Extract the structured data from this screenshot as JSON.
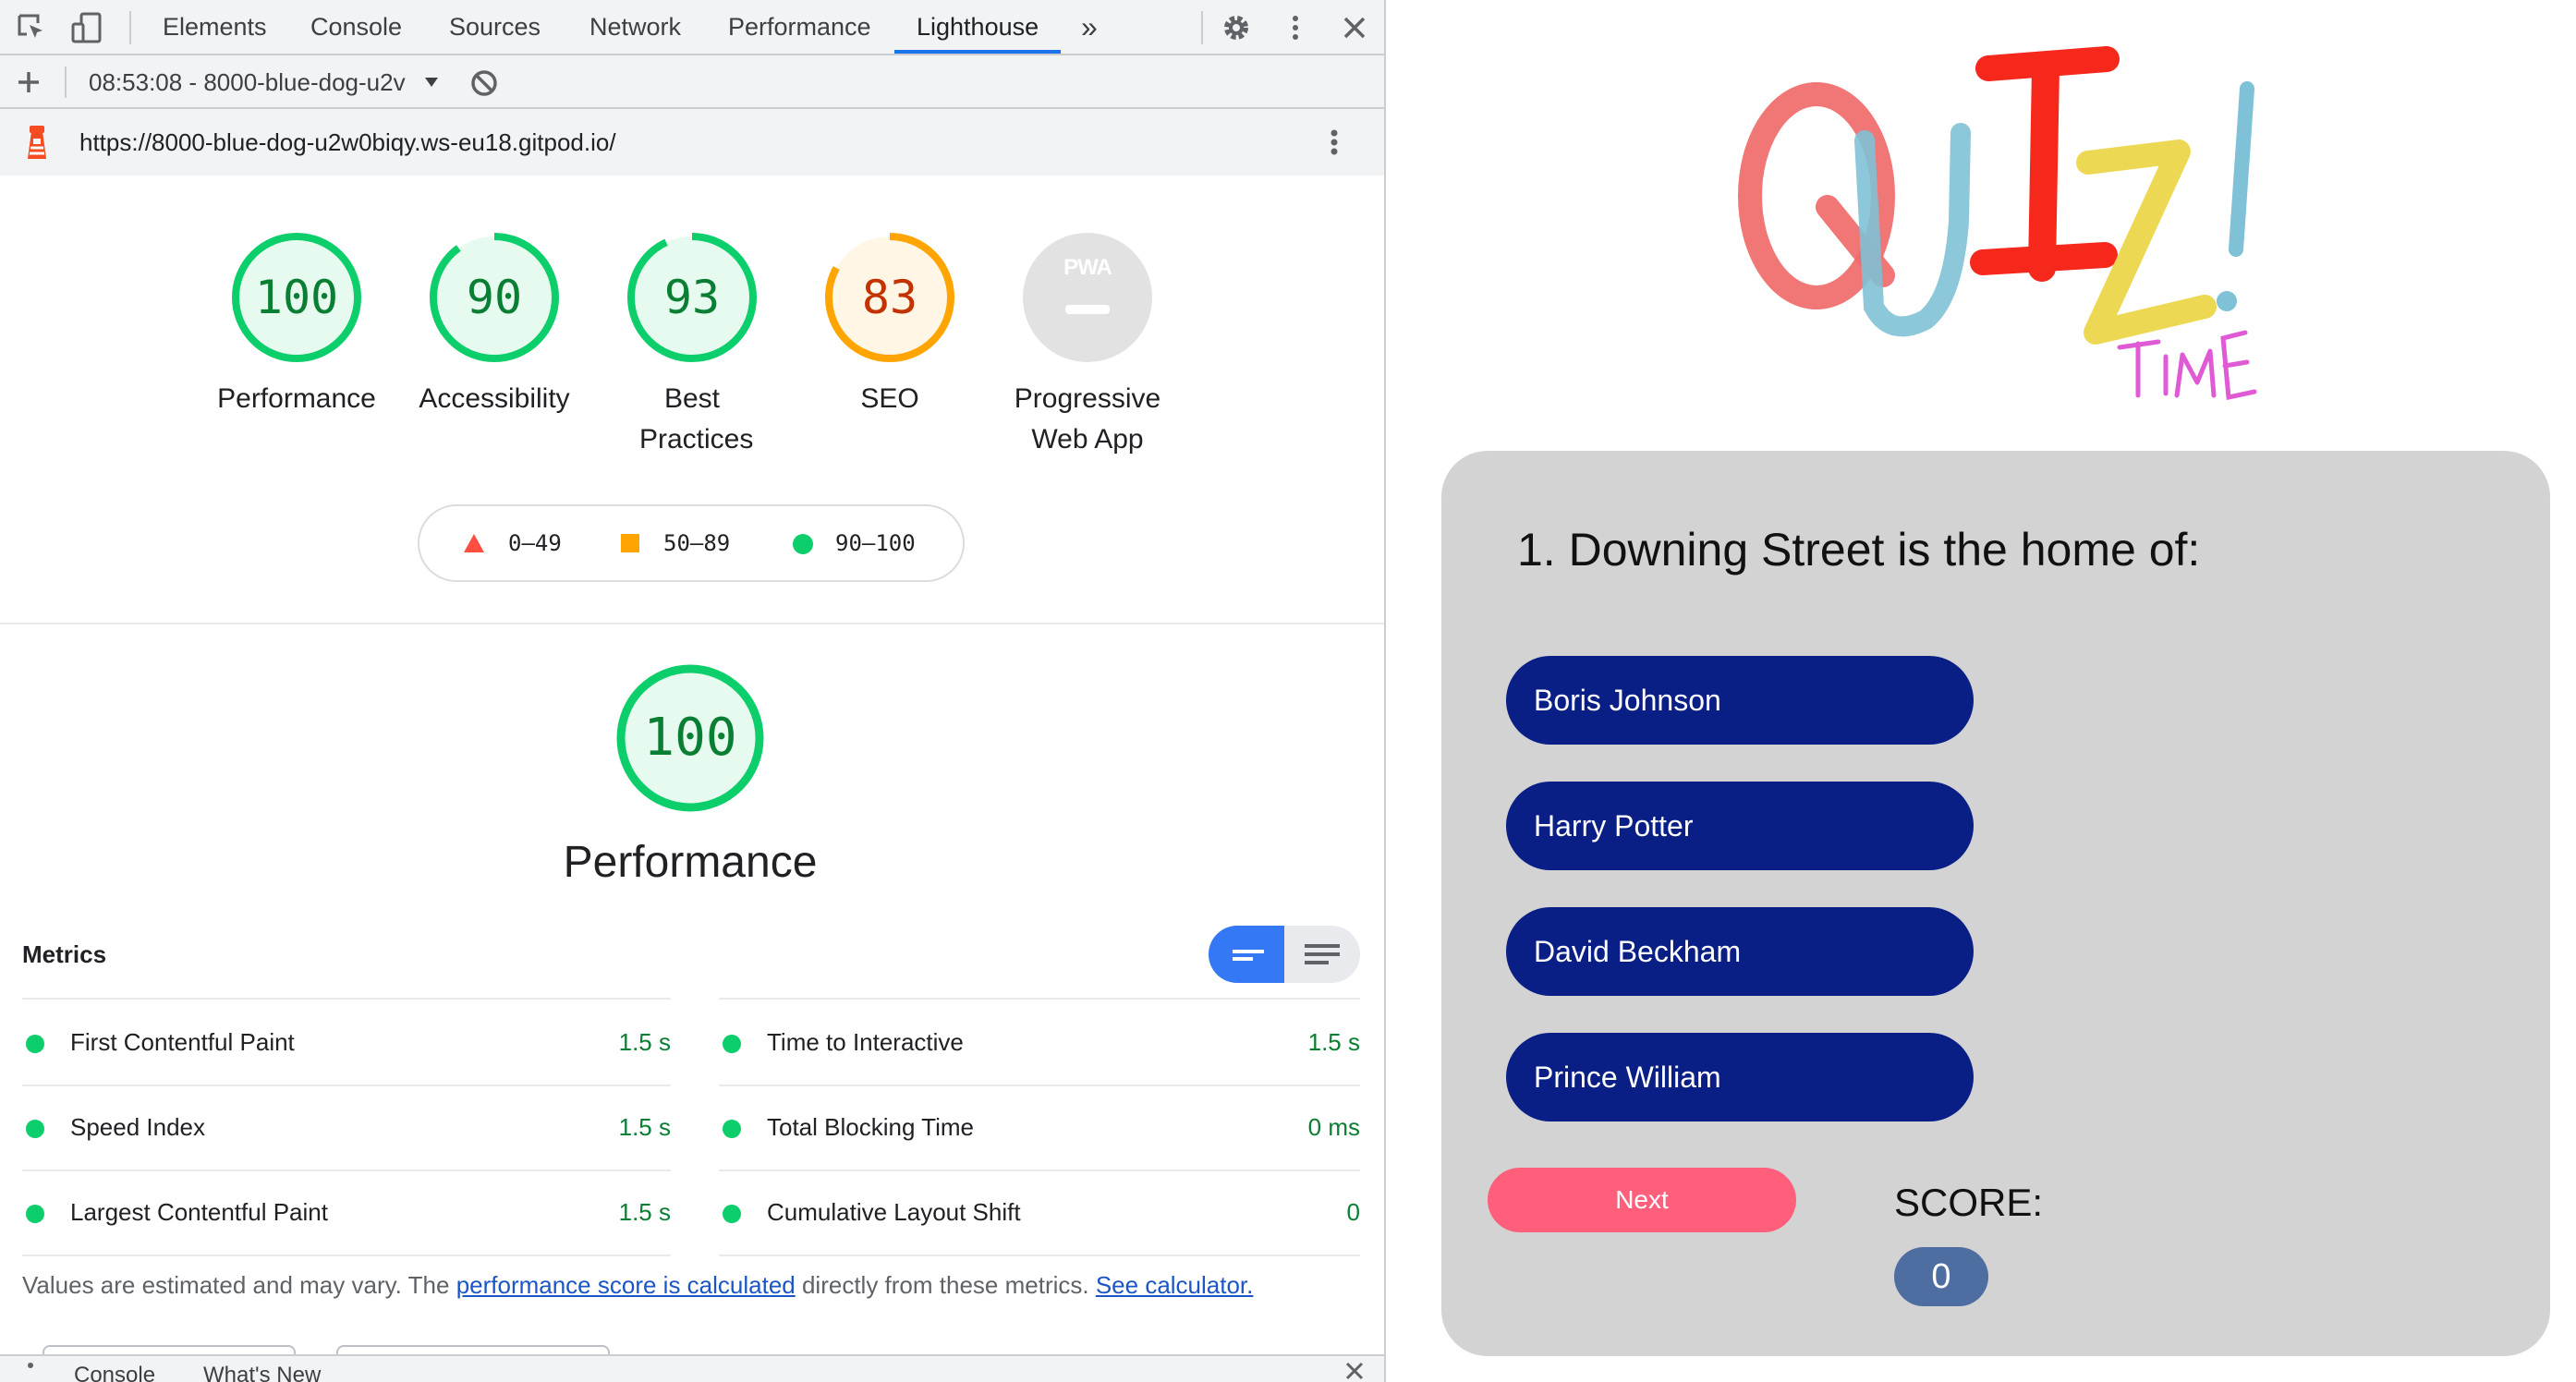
{
  "devtools": {
    "tabs": [
      "Elements",
      "Console",
      "Sources",
      "Network",
      "Performance",
      "Lighthouse"
    ],
    "more_tabs_glyph": "»",
    "report_selector": "08:53:08 - 8000-blue-dog-u2v",
    "url": "https://8000-blue-dog-u2w0biqy.ws-eu18.gitpod.io/",
    "scores": [
      {
        "value": "100",
        "label": "Performance",
        "color": "#0cce6b",
        "fraction": 1.0
      },
      {
        "value": "90",
        "label": "Accessibility",
        "color": "#0cce6b",
        "fraction": 0.9
      },
      {
        "value": "93",
        "label": "Best Practices",
        "color": "#0cce6b",
        "fraction": 0.93
      },
      {
        "value": "83",
        "label": "SEO",
        "color": "#ffa400",
        "fraction": 0.83
      }
    ],
    "pwa": {
      "badge": "PWA",
      "label": "Progressive Web App"
    },
    "legend": [
      "0–49",
      "50–89",
      "90–100"
    ],
    "performance": {
      "score": "100",
      "title": "Performance",
      "fraction": 1.0
    },
    "metrics_title": "Metrics",
    "metrics": [
      {
        "label": "First Contentful Paint",
        "value": "1.5 s"
      },
      {
        "label": "Time to Interactive",
        "value": "1.5 s"
      },
      {
        "label": "Speed Index",
        "value": "1.5 s"
      },
      {
        "label": "Total Blocking Time",
        "value": "0 ms"
      },
      {
        "label": "Largest Contentful Paint",
        "value": "1.5 s"
      },
      {
        "label": "Cumulative Layout Shift",
        "value": "0"
      }
    ],
    "note": {
      "prefix": "Values are estimated and may vary. The ",
      "link1": "performance score is calculated",
      "middle": " directly from these metrics. ",
      "link2": "See calculator."
    },
    "drawer": {
      "tab1": "Console",
      "tab2": "What's New"
    }
  },
  "quiz": {
    "logo_text": "QUIZ!",
    "logo_sub": "TIME",
    "question": "1. Downing Street is the home of:",
    "answers": [
      "Boris Johnson",
      "Harry Potter",
      "David Beckham",
      "Prince William"
    ],
    "next_label": "Next",
    "score_label": "SCORE:",
    "score_value": "0"
  },
  "colors": {
    "pass": "#0cce6b",
    "average": "#ffa400",
    "fail": "#ff4e42",
    "answer_bg": "#0a1f86",
    "next_bg": "#ff5f7b"
  }
}
